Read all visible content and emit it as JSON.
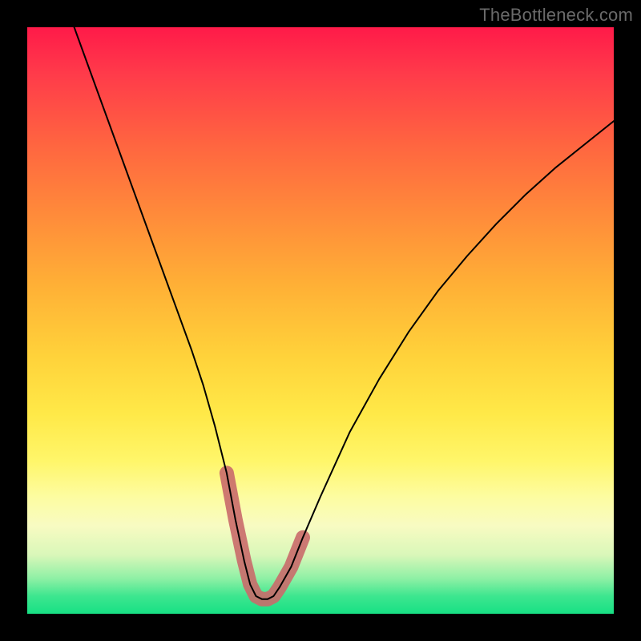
{
  "watermark": {
    "text": "TheBottleneck.com"
  },
  "chart_data": {
    "type": "line",
    "title": "",
    "xlabel": "",
    "ylabel": "",
    "xlim": [
      0,
      100
    ],
    "ylim": [
      0,
      100
    ],
    "grid": false,
    "legend": false,
    "series": [
      {
        "name": "curve",
        "color": "#000000",
        "x": [
          8,
          12,
          16,
          20,
          24,
          28,
          30,
          32,
          34,
          35.5,
          37,
          38,
          39,
          40,
          41,
          42,
          43,
          45,
          47,
          50,
          55,
          60,
          65,
          70,
          75,
          80,
          85,
          90,
          95,
          100
        ],
        "values": [
          100,
          89,
          78,
          67,
          56,
          45,
          39,
          32,
          24,
          16,
          9,
          5,
          3,
          2.5,
          2.5,
          3,
          4.5,
          8,
          13,
          20,
          31,
          40,
          48,
          55,
          61,
          66.5,
          71.5,
          76,
          80,
          84
        ]
      },
      {
        "name": "highlight",
        "color": "#c96a6a",
        "x": [
          34,
          35.5,
          37,
          38,
          39,
          40,
          41,
          42,
          43,
          45,
          47
        ],
        "values": [
          24,
          16,
          9,
          5,
          3,
          2.5,
          2.5,
          3,
          4.5,
          8,
          13
        ]
      }
    ]
  }
}
